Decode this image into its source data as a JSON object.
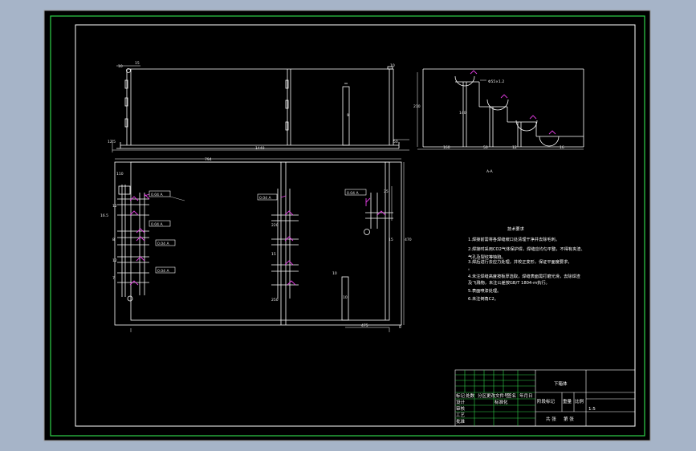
{
  "drawing": {
    "colors": {
      "background": "#a6b4c8",
      "sheet": "#000000",
      "frame": "#2fd14a",
      "line": "#ffffff",
      "symbol": "#e23ce2",
      "titleblock_grid": "#2fd14a"
    },
    "top_view": {
      "dims": [
        "10",
        "15",
        "12.5",
        "1440",
        "10",
        "50",
        "9"
      ]
    },
    "side_view": {
      "callout": "Φ55×1.2",
      "dims": [
        "160",
        "50",
        "12",
        "16",
        "210",
        "140"
      ],
      "scale_label": "A-A"
    },
    "front_view": {
      "callouts": [
        "0.04 A",
        "0.04 A",
        "0.04 A",
        "0.04 A",
        "0.04 A",
        "0.04 A"
      ],
      "dims": [
        "794",
        "110",
        "16.5",
        "12",
        "8",
        "12",
        "7",
        "10",
        "470",
        "25",
        "15",
        "220",
        "250",
        "15",
        "8",
        "10",
        "475"
      ]
    },
    "tech_requirements": {
      "title": "技术要求",
      "lines": [
        "1.焊接前需将各焊缝坡口处清理干净并去除毛刺。",
        "2.焊接时采用CO2气体保护焊，焊缝应均匀平整，不得有夹渣、",
        "  气孔及裂纹等缺陷。",
        "3.焊后进行去应力处理，并校正变形，保证平面度要求，",
        "  。",
        "4.未注焊缝高度按板厚选取，焊缝表面需打磨光滑，去除焊渣",
        "  及飞溅物，未注公差按GB/T 1804-m执行。",
        "5.表面喷漆处理。",
        "6.未注倒角C2。"
      ]
    },
    "title_block": {
      "part_name": "下箱体",
      "row_labels": [
        "标记",
        "处数",
        "分区",
        "更改文件号",
        "签名",
        "年月日"
      ],
      "left_labels": [
        "设计",
        "审核",
        "工艺",
        "批准"
      ],
      "std_label": "标准化",
      "stage_labels": [
        "阶段标记",
        "重量",
        "比例"
      ],
      "scale": "1:5",
      "sheet_labels": [
        "共 张",
        "第 张"
      ]
    }
  }
}
